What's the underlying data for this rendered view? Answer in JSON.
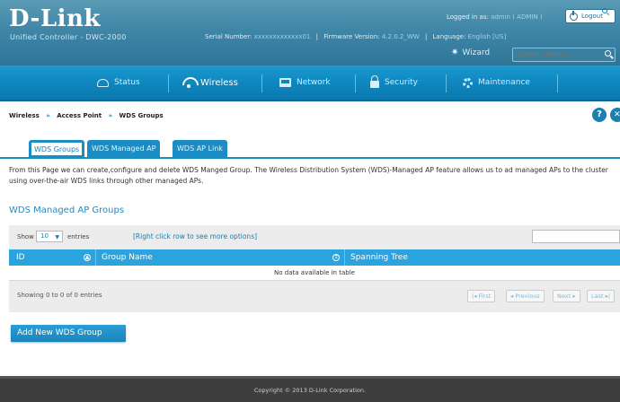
{
  "header": {
    "brand": "D-Link",
    "product": "Unified Controller - DWC-2000",
    "serial_label": "Serial Number:",
    "serial_value": "xxxxxxxxxxxxx01",
    "firmware_label": "Firmware Version:",
    "firmware_value": "4.2.0.2_WW",
    "language_label": "Language:",
    "language_value": "English [US]",
    "logged_in_label": "Logged in as:",
    "logged_in_value": "admin ( ADMIN )",
    "logout_label": "Logout",
    "wizard_label": "Wizard",
    "search_placeholder": "System Search..."
  },
  "nav": {
    "items": [
      {
        "label": "Status",
        "icon": "status-icon"
      },
      {
        "label": "Wireless",
        "icon": "wifi-icon"
      },
      {
        "label": "Network",
        "icon": "network-icon"
      },
      {
        "label": "Security",
        "icon": "lock-icon"
      },
      {
        "label": "Maintenance",
        "icon": "gear-icon"
      }
    ],
    "active": "Wireless"
  },
  "breadcrumb": {
    "items": [
      "Wireless",
      "Access Point",
      "WDS Groups"
    ],
    "separator": "»"
  },
  "help_label": "?",
  "tabs": [
    "WDS Groups",
    "WDS Managed AP",
    "WDS AP Link"
  ],
  "description": "From this Page we can create,configure and delete WDS Manged Group. The Wireless Distribution System (WDS)-Managed AP feature allows us to ad managed APs to the cluster using over-the-air WDS links through other managed APs.",
  "section_title": "WDS Managed AP Groups",
  "table": {
    "show_label": "Show",
    "show_value": "10",
    "entries_label": "entries",
    "hint": "[Right click row to see more options]",
    "columns": [
      "ID",
      "Group Name",
      "Spanning Tree"
    ],
    "empty_text": "No data available in table",
    "info": "Showing 0 to 0 of 0 entries",
    "pagination": [
      "First",
      "Previous",
      "Next",
      "Last"
    ]
  },
  "add_button_label": "Add New WDS Group",
  "footer_text": "Copyright © 2013 D-Link Corporation.",
  "colors": {
    "header": "#3f86a7",
    "nav": "#0f86bf",
    "accent": "#1c8dc4",
    "table_header": "#2aa3de",
    "footer": "#3e3e3e"
  }
}
